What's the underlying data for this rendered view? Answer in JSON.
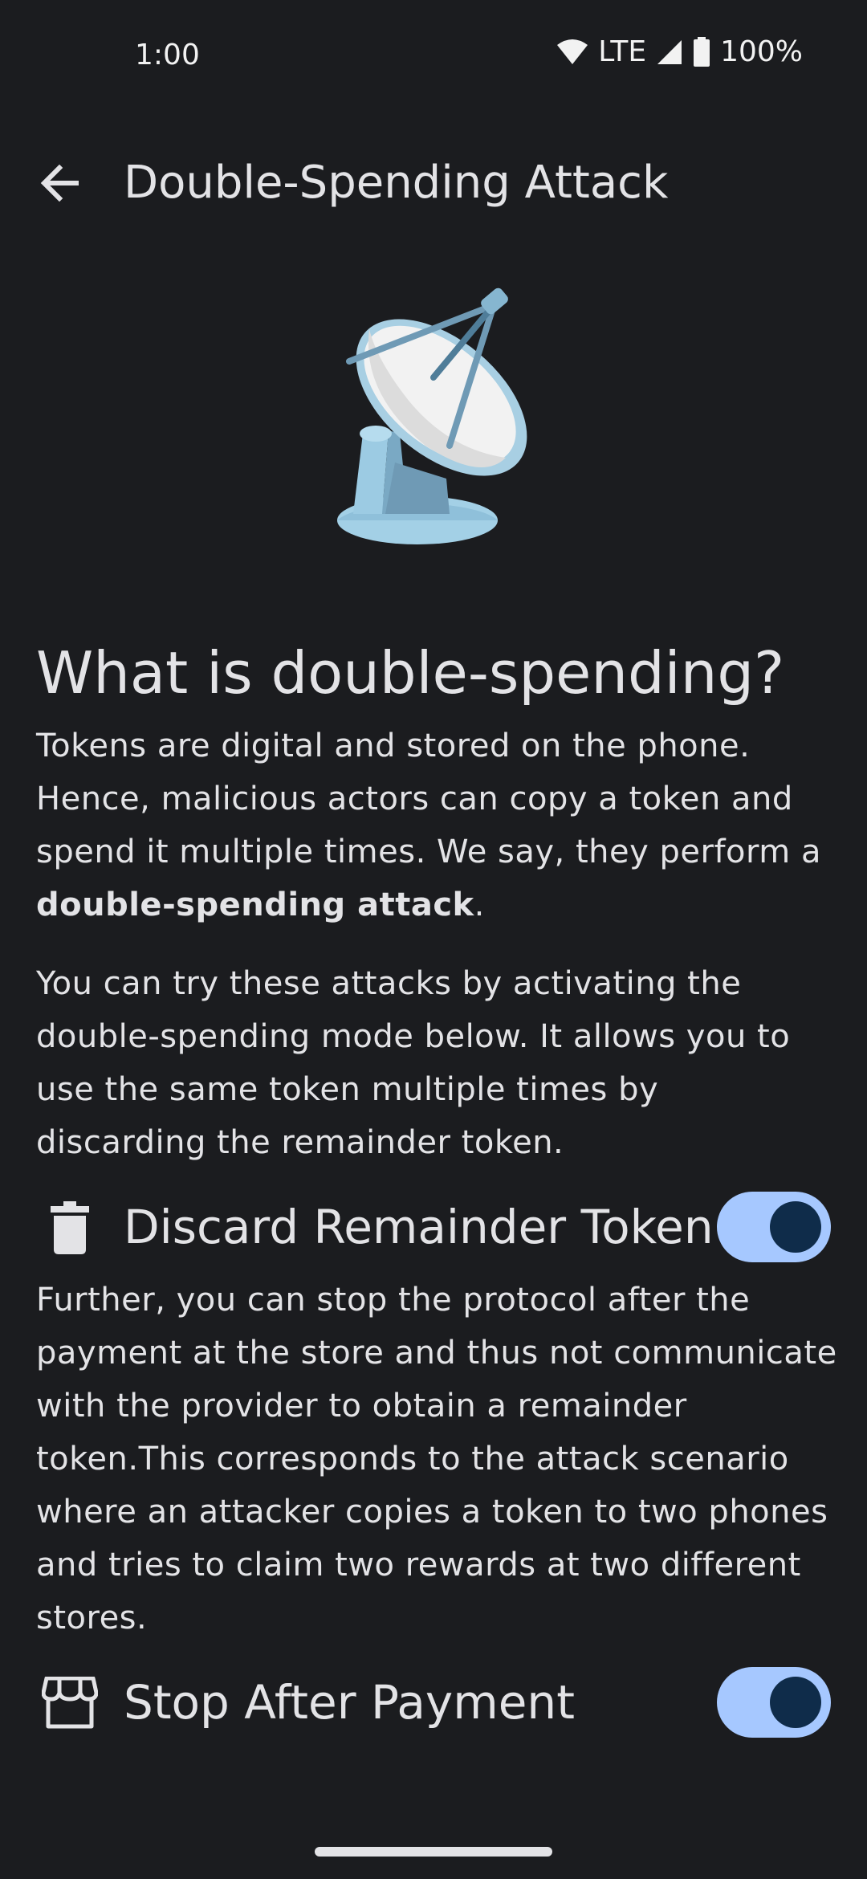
{
  "status_bar": {
    "time": "1:00",
    "network": "LTE",
    "battery": "100%"
  },
  "app_bar": {
    "title": "Double-Spending Attack"
  },
  "illustration": {
    "icon": "satellite-dish-icon"
  },
  "content": {
    "heading": "What is double-spending?",
    "intro_text": "Tokens are digital and stored on the phone. Hence, malicious actors can copy a token and spend it multiple times. We say, they perform a ",
    "intro_bold": "double-spending attack",
    "intro_end": ".",
    "try_text": "You can try these attacks by activating the double-spending mode below. It allows you to use the same token multiple times by discarding the remainder token.",
    "further_text": "Further, you can stop the protocol after the payment at the store and thus not communicate with the provider to obtain a remainder token.This corresponds to the attack scenario where an attacker copies a token to two phones and tries to claim two rewards at two different stores."
  },
  "settings": {
    "discard_remainder": {
      "label": "Discard Remainder Token",
      "icon": "trash-icon",
      "enabled": true
    },
    "stop_after_payment": {
      "label": "Stop After Payment",
      "icon": "store-icon",
      "enabled": true
    }
  },
  "colors": {
    "background": "#1b1c1f",
    "toggle_track": "#a6c8ff",
    "toggle_thumb": "#0f2c4a",
    "text": "#e3e3e6"
  }
}
